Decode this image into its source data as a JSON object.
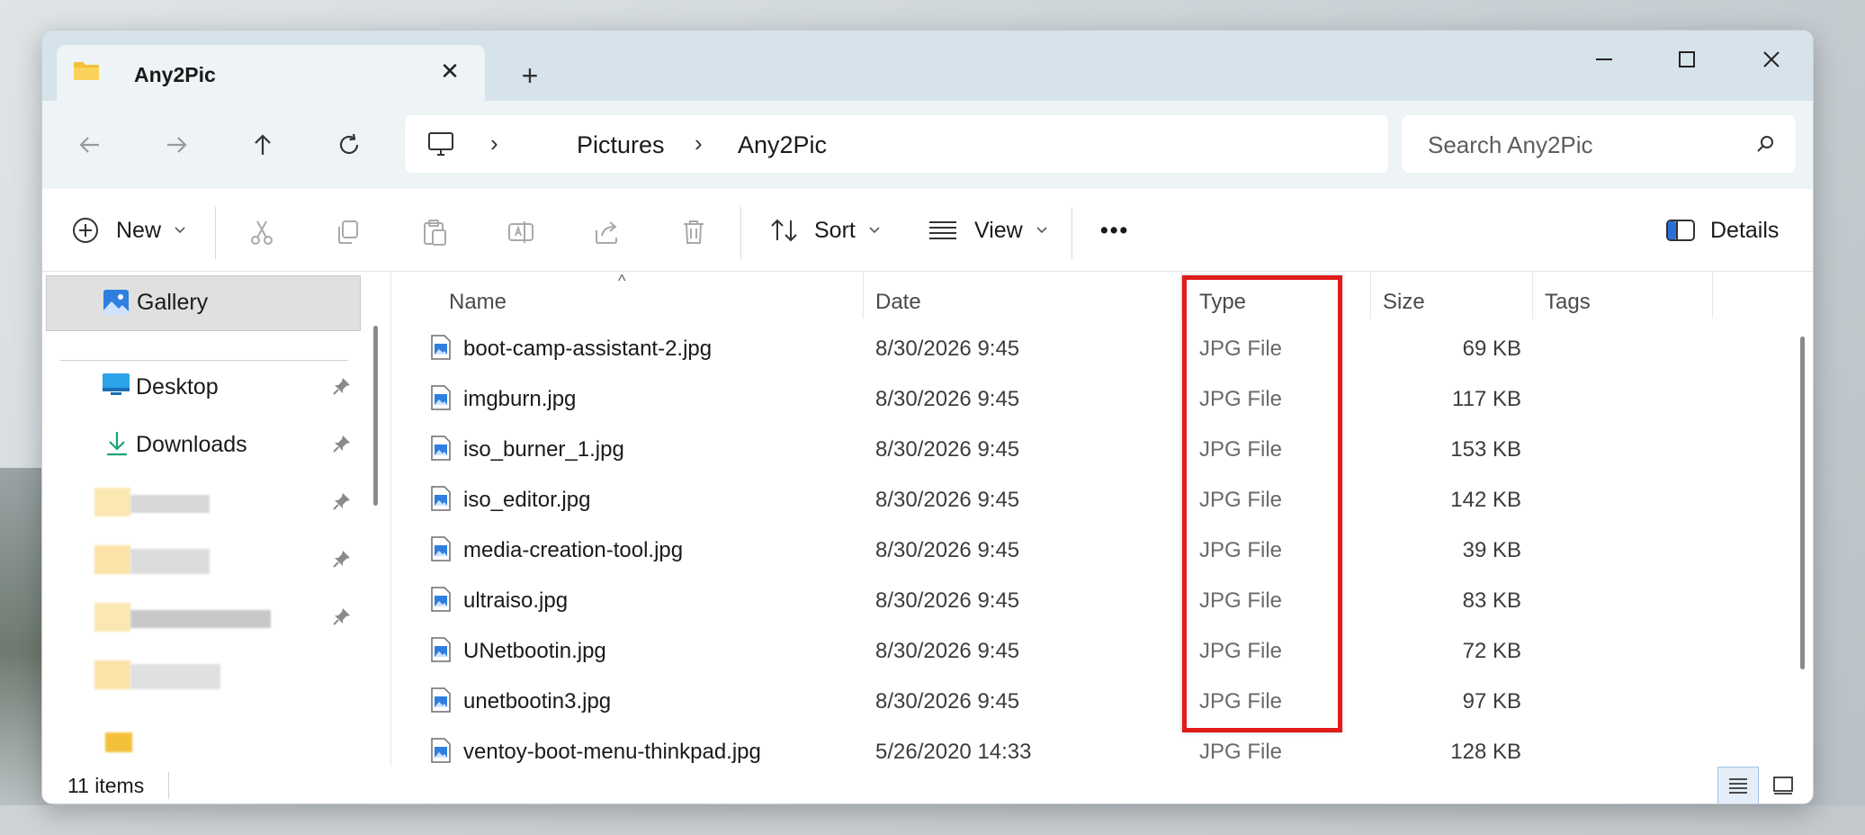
{
  "window": {
    "tab_title": "Any2Pic",
    "new_tab_glyph": "+",
    "close_tab_glyph": "✕"
  },
  "navigation": {
    "breadcrumb": [
      "Pictures",
      "Any2Pic"
    ],
    "search_placeholder": "Search Any2Pic"
  },
  "toolbar": {
    "new_label": "New",
    "sort_label": "Sort",
    "view_label": "View",
    "more_label": "•••",
    "details_label": "Details"
  },
  "sidebar": {
    "gallery_label": "Gallery",
    "desktop_label": "Desktop",
    "downloads_label": "Downloads"
  },
  "columns": {
    "name": "Name",
    "date": "Date",
    "type": "Type",
    "size": "Size",
    "tags": "Tags"
  },
  "files": [
    {
      "name": "boot-camp-assistant-2.jpg",
      "date": "8/30/2026 9:45",
      "type": "JPG File",
      "size": "69 KB"
    },
    {
      "name": "imgburn.jpg",
      "date": "8/30/2026 9:45",
      "type": "JPG File",
      "size": "117 KB"
    },
    {
      "name": "iso_burner_1.jpg",
      "date": "8/30/2026 9:45",
      "type": "JPG File",
      "size": "153 KB"
    },
    {
      "name": "iso_editor.jpg",
      "date": "8/30/2026 9:45",
      "type": "JPG File",
      "size": "142 KB"
    },
    {
      "name": "media-creation-tool.jpg",
      "date": "8/30/2026 9:45",
      "type": "JPG File",
      "size": "39 KB"
    },
    {
      "name": "ultraiso.jpg",
      "date": "8/30/2026 9:45",
      "type": "JPG File",
      "size": "83 KB"
    },
    {
      "name": "UNetbootin.jpg",
      "date": "8/30/2026 9:45",
      "type": "JPG File",
      "size": "72 KB"
    },
    {
      "name": "unetbootin3.jpg",
      "date": "8/30/2026 9:45",
      "type": "JPG File",
      "size": "97 KB"
    },
    {
      "name": "ventoy-boot-menu-thinkpad.jpg",
      "date": "5/26/2020 14:33",
      "type": "JPG File",
      "size": "128 KB"
    }
  ],
  "status": {
    "item_count": "11 items"
  },
  "colors": {
    "highlight": "#e01b1b",
    "titlebar": "#d6e3ea"
  }
}
